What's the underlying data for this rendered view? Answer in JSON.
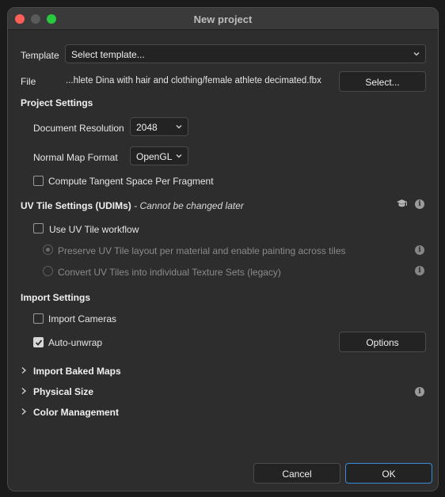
{
  "window": {
    "title": "New project"
  },
  "template": {
    "label": "Template",
    "value": "Select template..."
  },
  "file": {
    "label": "File",
    "path": "...hlete Dina with hair and clothing/female athlete decimated.fbx",
    "select_button": "Select..."
  },
  "project_settings": {
    "heading": "Project Settings",
    "document_resolution": {
      "label": "Document Resolution",
      "value": "2048"
    },
    "normal_map_format": {
      "label": "Normal Map Format",
      "value": "OpenGL"
    },
    "compute_tangent": {
      "label": "Compute Tangent Space Per Fragment",
      "checked": false
    }
  },
  "uv_tile_settings": {
    "heading": "UV Tile Settings (UDIMs)",
    "note": " - Cannot be changed later",
    "use_uv_tile": {
      "label": "Use UV Tile workflow",
      "checked": false
    },
    "option_preserve": {
      "label": "Preserve UV Tile layout per material and enable painting across tiles",
      "selected": true
    },
    "option_convert": {
      "label": "Convert UV Tiles into individual Texture Sets (legacy)",
      "selected": false
    }
  },
  "import_settings": {
    "heading": "Import Settings",
    "import_cameras": {
      "label": "Import Cameras",
      "checked": false
    },
    "auto_unwrap": {
      "label": "Auto-unwrap",
      "checked": true
    },
    "options_button": "Options"
  },
  "collapsible_sections": [
    {
      "label": "Import Baked Maps"
    },
    {
      "label": "Physical Size"
    },
    {
      "label": "Color Management"
    }
  ],
  "footer": {
    "cancel": "Cancel",
    "ok": "OK"
  },
  "colors": {
    "accent": "#3b8bd9",
    "background": "#2d2d2d",
    "field": "#232323"
  },
  "icons": [
    "chevron-down-icon",
    "graduation-cap-icon",
    "info-icon",
    "chevron-right-icon",
    "checkmark-icon"
  ]
}
